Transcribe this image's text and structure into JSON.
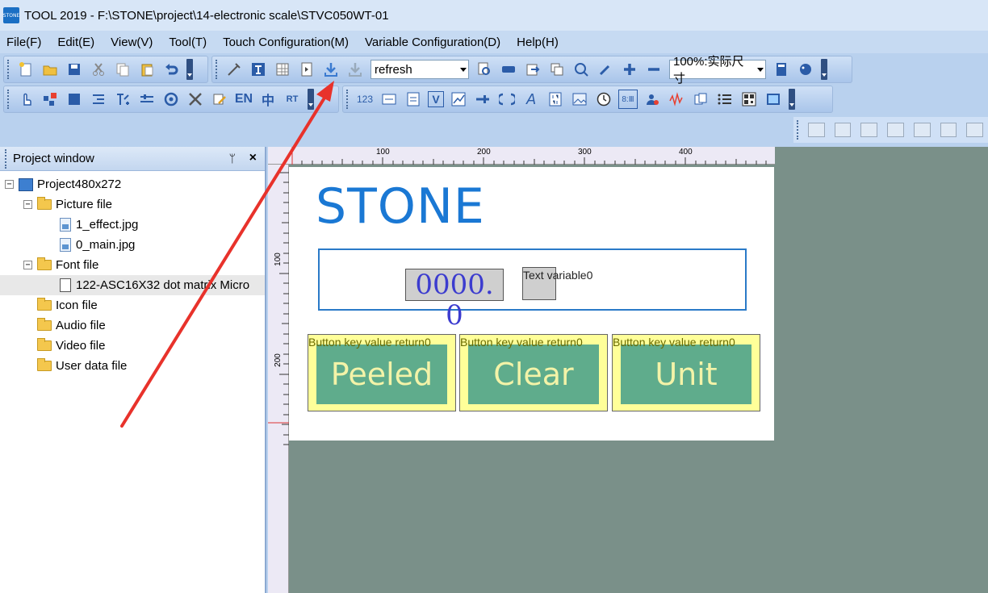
{
  "window": {
    "app_logo": "STONE",
    "title": "TOOL 2019 - F:\\STONE\\project\\14-electronic scale\\STVC050WT-01"
  },
  "menu": [
    "File(F)",
    "Edit(E)",
    "View(V)",
    "Tool(T)",
    "Touch Configuration(M)",
    "Variable Configuration(D)",
    "Help(H)"
  ],
  "toolbar": {
    "refresh_combo": "refresh",
    "zoom_combo": "100%:实际尺寸",
    "en_label": "EN",
    "zh_label": "中",
    "rt_label": "RT",
    "num_label": "123",
    "v_label": "V",
    "bmp_label": "8:Ⅲ",
    "lang_label": "A"
  },
  "project_panel": {
    "title": "Project window",
    "pin": "ᛘ",
    "close": "×",
    "root": "Project480x272",
    "picture_folder": "Picture file",
    "picture_files": [
      "1_effect.jpg",
      "0_main.jpg"
    ],
    "font_folder": "Font file",
    "font_files": [
      "122-ASC16X32 dot matrix Micro"
    ],
    "icon_folder": "Icon file",
    "audio_folder": "Audio file",
    "video_folder": "Video file",
    "user_folder": "User data file"
  },
  "ruler": {
    "top_ticks": [
      "100",
      "200",
      "300",
      "400"
    ],
    "left_ticks": [
      "100",
      "200"
    ]
  },
  "screen": {
    "logo": "STONE",
    "weight_value": "0000. 0",
    "text_variable": "Text variable0",
    "buttons": [
      {
        "caption": "Button key value return0",
        "label": "Peeled"
      },
      {
        "caption": "Button key value return0",
        "label": "Clear"
      },
      {
        "caption": "Button key value return0",
        "label": "Unit"
      }
    ]
  },
  "colors": {
    "annotation_arrow": "#e8322b",
    "canvas_bg": "#7a9089",
    "button_fill": "#5fac8c",
    "button_frame": "#ffff99",
    "logo_blue": "#1a78d4"
  }
}
